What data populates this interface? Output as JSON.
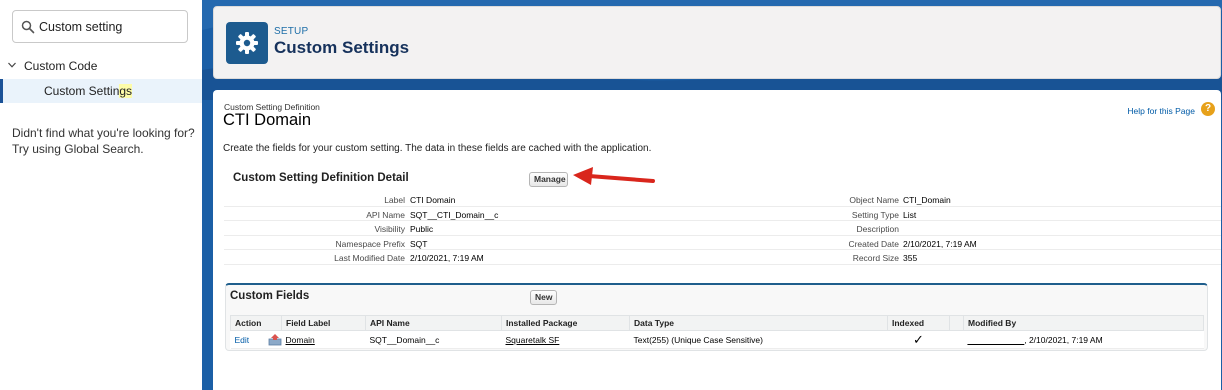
{
  "sidebar": {
    "search_value": "Custom setting",
    "tree_group_label": "Custom Code",
    "tree_item_prefix": "Custom Settin",
    "tree_item_highlight": "gs",
    "help_line1": "Didn't find what you're looking for?",
    "help_line2": "Try using Global Search."
  },
  "header": {
    "eyebrow": "SETUP",
    "title": "Custom Settings",
    "icon": "gear-icon"
  },
  "record": {
    "crumb": "Custom Setting Definition",
    "title": "CTI Domain",
    "help_link": "Help for this Page",
    "description": "Create the fields for your custom setting. The data in these fields are cached with the application."
  },
  "detail": {
    "section_title": "Custom Setting Definition Detail",
    "manage_label": "Manage",
    "rows": [
      {
        "label1": "Label",
        "value1": "CTI Domain",
        "label2": "Object Name",
        "value2": "CTI_Domain"
      },
      {
        "label1": "API Name",
        "value1": "SQT__CTI_Domain__c",
        "label2": "Setting Type",
        "value2": "List"
      },
      {
        "label1": "Visibility",
        "value1": "Public",
        "label2": "Description",
        "value2": ""
      },
      {
        "label1": "Namespace Prefix",
        "value1": "SQT",
        "label2": "Created Date",
        "value2": "2/10/2021, 7:19 AM"
      },
      {
        "label1": "Last Modified Date",
        "value1": "2/10/2021, 7:19 AM",
        "label2": "Record Size",
        "value2": "355"
      }
    ]
  },
  "custom_fields": {
    "title": "Custom Fields",
    "new_label": "New",
    "columns": [
      "Action",
      "Field Label",
      "API Name",
      "Installed Package",
      "Data Type",
      "Indexed",
      "Modified By"
    ],
    "rows": [
      {
        "action": "Edit",
        "field_label": "Domain",
        "api_name": "SQT__Domain__c",
        "installed_package": "Squaretalk SF",
        "data_type": "Text(255) (Unique Case Sensitive)",
        "indexed": "✓",
        "modified_by_user": "____________",
        "modified_by_date": ", 2/10/2021, 7:19 AM"
      }
    ]
  },
  "colors": {
    "brand_blue": "#1b5fa6",
    "header_icon_bg": "#1d5b8f",
    "link": "#015ba7",
    "annotation_arrow": "#d9261c"
  }
}
